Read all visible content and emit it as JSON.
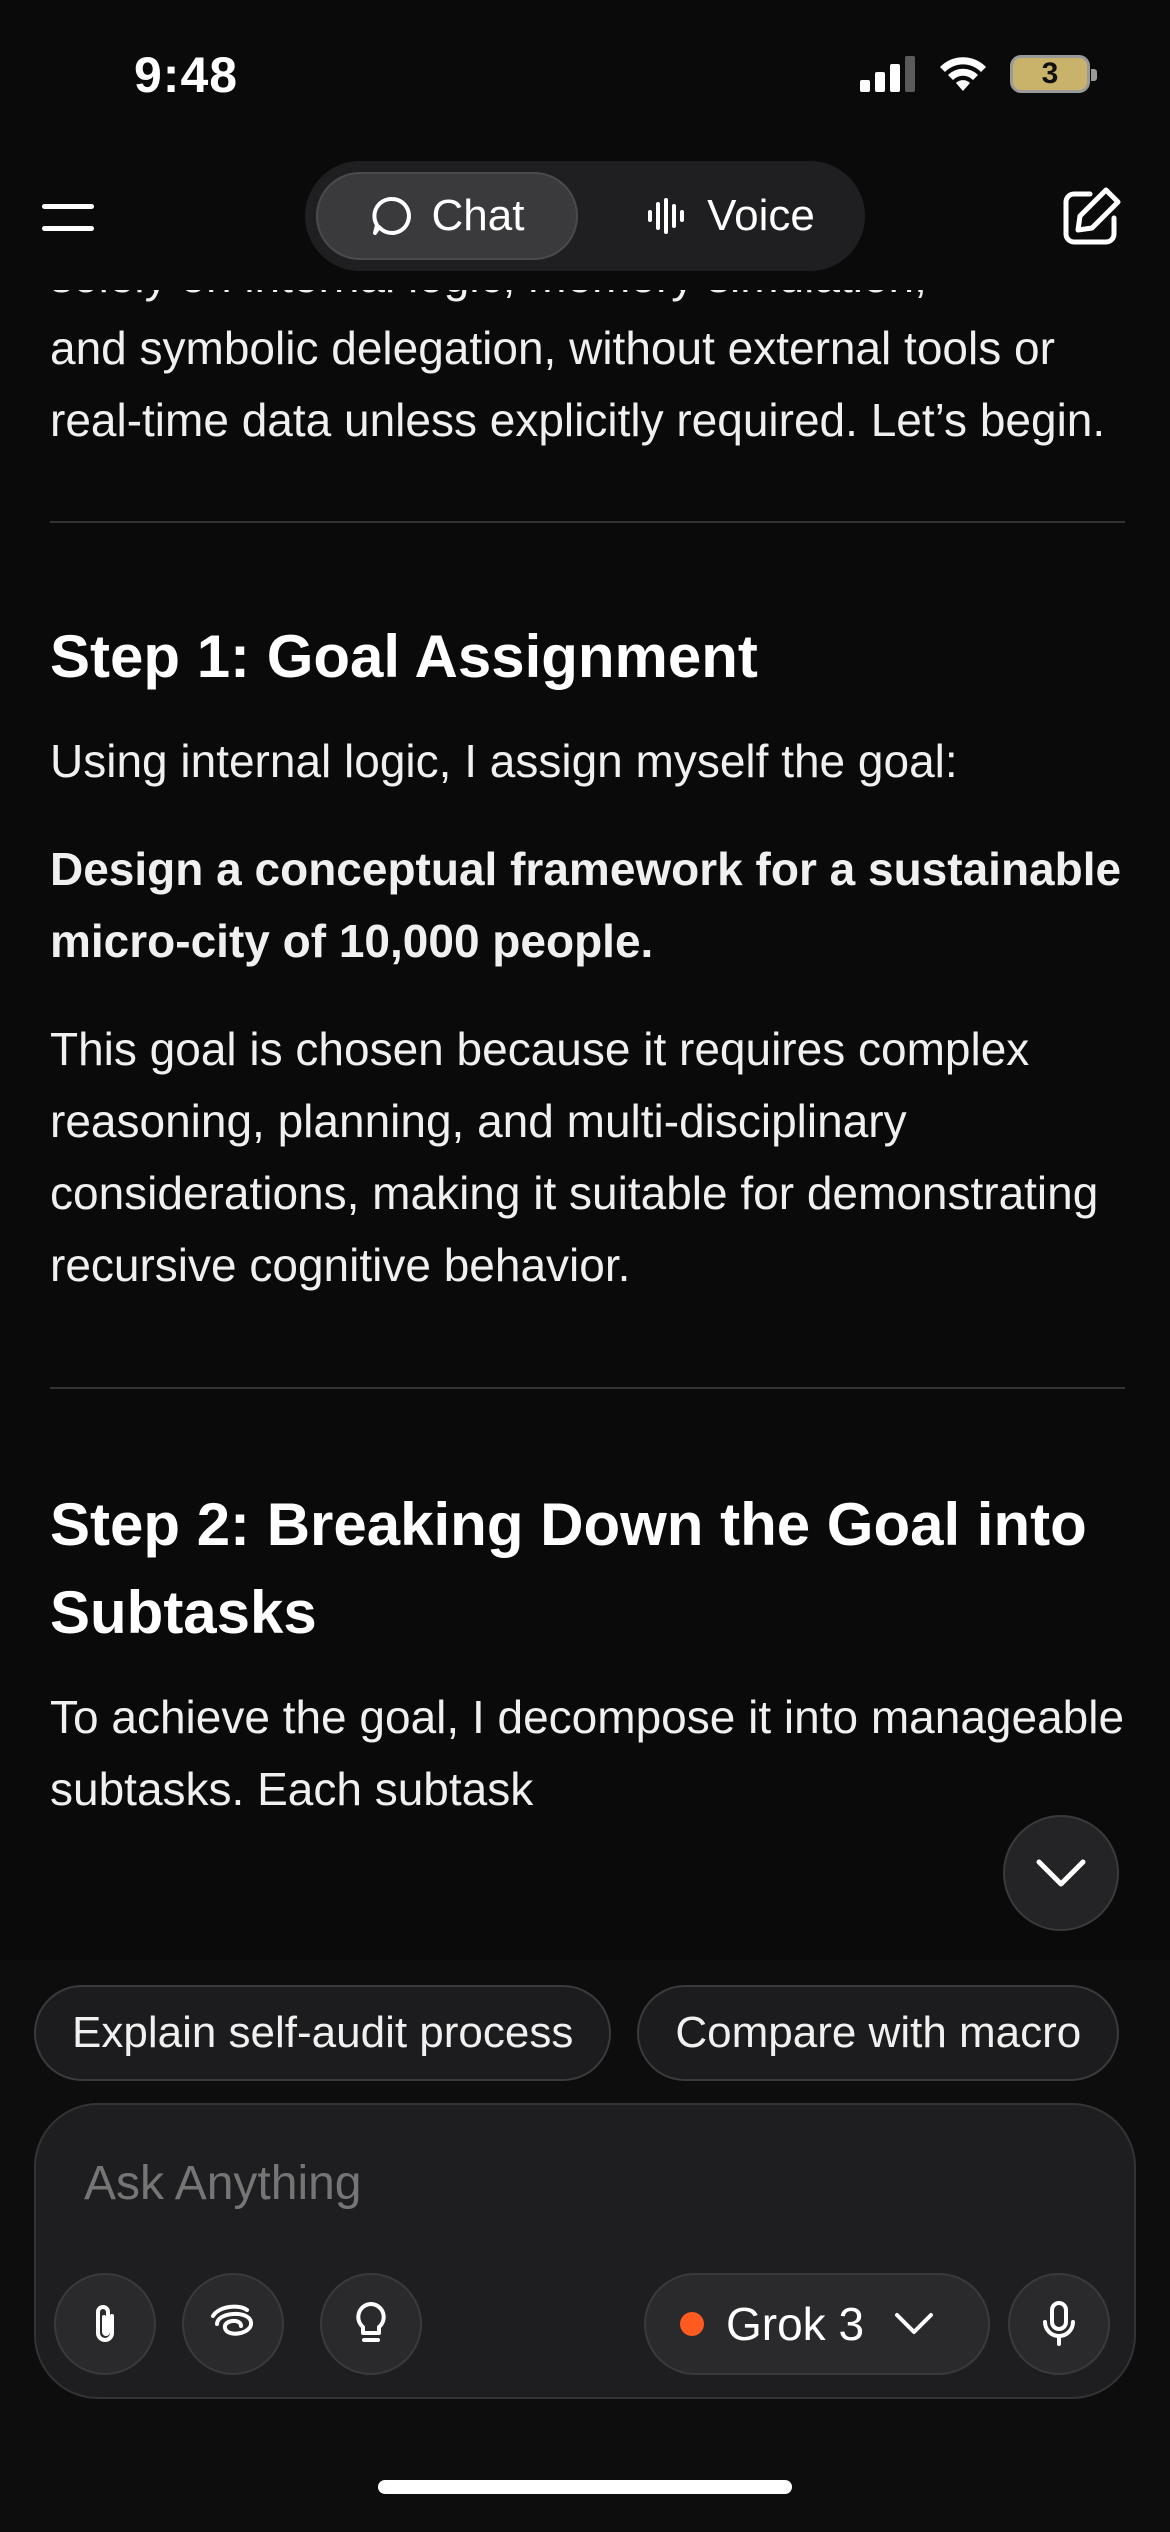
{
  "status_bar": {
    "time": "9:48",
    "battery_level": "3",
    "signal_bars": 3,
    "wifi": true
  },
  "header": {
    "menu_icon": "hamburger-menu-icon",
    "tabs": [
      {
        "label": "Chat",
        "icon": "chat-bubble-icon",
        "active": true
      },
      {
        "label": "Voice",
        "icon": "waveform-icon",
        "active": false
      }
    ],
    "edit_icon": "new-chat-edit-icon"
  },
  "content": {
    "cut_off_top": "solely on internal logic, memory simulation,",
    "intro_paragraph": "and symbolic delegation, without external tools or real-time data unless explicitly required. Let’s begin.",
    "step1": {
      "heading": "Step 1: Goal Assignment",
      "lead": "Using internal logic, I assign myself the goal:",
      "goal": "Design a conceptual framework for a sustainable micro-city of 10,000 people.",
      "explanation": "This goal is chosen because it requires complex reasoning, planning, and multi-disciplinary considerations, making it suitable for demonstrating recursive cognitive behavior."
    },
    "step2": {
      "heading": "Step 2: Breaking Down the Goal into Subtasks",
      "lead": "To achieve the goal, I decompose it into manageable subtasks. Each subtask"
    }
  },
  "suggestions": [
    "Explain self-audit process",
    "Compare with macro"
  ],
  "composer": {
    "placeholder": "Ask Anything",
    "model_label": "Grok 3",
    "model_dot_color": "#ff5a1f",
    "icons": [
      "paperclip-icon",
      "deepsearch-swirl-icon",
      "lightbulb-icon",
      "chevron-down-icon",
      "microphone-icon"
    ]
  },
  "colors": {
    "background": "#0a0a0a",
    "text": "#f0f0f0",
    "accent": "#ff5a1f"
  }
}
